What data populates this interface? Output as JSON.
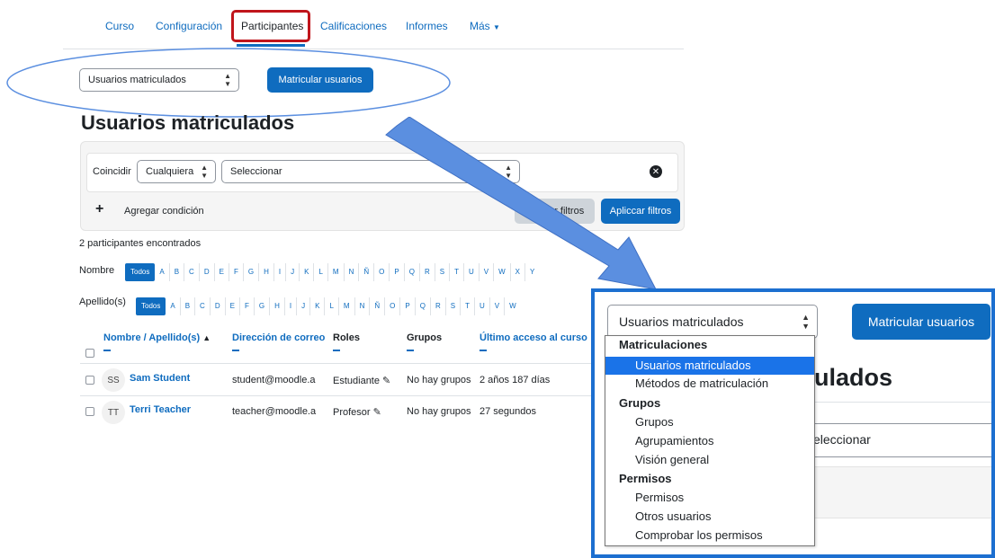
{
  "nav": {
    "items": [
      "Curso",
      "Configuración",
      "Participantes",
      "Calificaciones",
      "Informes",
      "Más"
    ],
    "active": "Participantes"
  },
  "top": {
    "select_value": "Usuarios matriculados",
    "enrol_button": "Matricular usuarios"
  },
  "page_title": "Usuarios matriculados",
  "filter": {
    "match_label": "Coincidir",
    "match_value": "Cualquiera",
    "select_placeholder": "Seleccionar",
    "add_condition": "Agregar condición",
    "clear_button": "Limpiar filtros",
    "apply_button": "Apliccar filtros"
  },
  "participants_found": "2 participantes encontrados",
  "initials_filters": {
    "firstname_label": "Nombre",
    "lastname_label": "Apellido(s)",
    "all_label": "Todos",
    "letters_firstname": [
      "A",
      "B",
      "C",
      "D",
      "E",
      "F",
      "G",
      "H",
      "I",
      "J",
      "K",
      "L",
      "M",
      "N",
      "Ñ",
      "O",
      "P",
      "Q",
      "R",
      "S",
      "T",
      "U",
      "V",
      "W",
      "X",
      "Y"
    ],
    "letters_lastname": [
      "A",
      "B",
      "C",
      "D",
      "E",
      "F",
      "G",
      "H",
      "I",
      "J",
      "K",
      "L",
      "M",
      "N",
      "Ñ",
      "O",
      "P",
      "Q",
      "R",
      "S",
      "T",
      "U",
      "V",
      "W"
    ]
  },
  "table": {
    "headers": {
      "name": "Nombre / Apellido(s)",
      "email": "Dirección de correo",
      "roles": "Roles",
      "groups": "Grupos",
      "last_access": "Último acceso al curso"
    },
    "rows": [
      {
        "initials": "SS",
        "name": "Sam Student",
        "email": "student@moodle.a",
        "role": "Estudiante",
        "groups": "No hay grupos",
        "last_access": "2 años 187 días"
      },
      {
        "initials": "TT",
        "name": "Terri Teacher",
        "email": "teacher@moodle.a",
        "role": "Profesor",
        "groups": "No hay grupos",
        "last_access": "27 segundos"
      }
    ]
  },
  "zoom": {
    "select_value": "Usuarios matriculados",
    "enrol_button": "Matricular usuarios",
    "title_fragment": "ulados",
    "placeholder_fragment": "eleccionar",
    "dropdown": {
      "group1": "Matriculaciones",
      "g1_items": [
        "Usuarios matriculados",
        "Métodos de matriculación"
      ],
      "group2": "Grupos",
      "g2_items": [
        "Grupos",
        "Agrupamientos",
        "Visión general"
      ],
      "group3": "Permisos",
      "g3_items": [
        "Permisos",
        "Otros usuarios",
        "Comprobar los permisos"
      ]
    }
  },
  "colors": {
    "accent": "#0f6cbf",
    "highlight_red": "#c0151b",
    "zoom_border": "#1c6fd0",
    "arrow": "#5b8fe0"
  }
}
